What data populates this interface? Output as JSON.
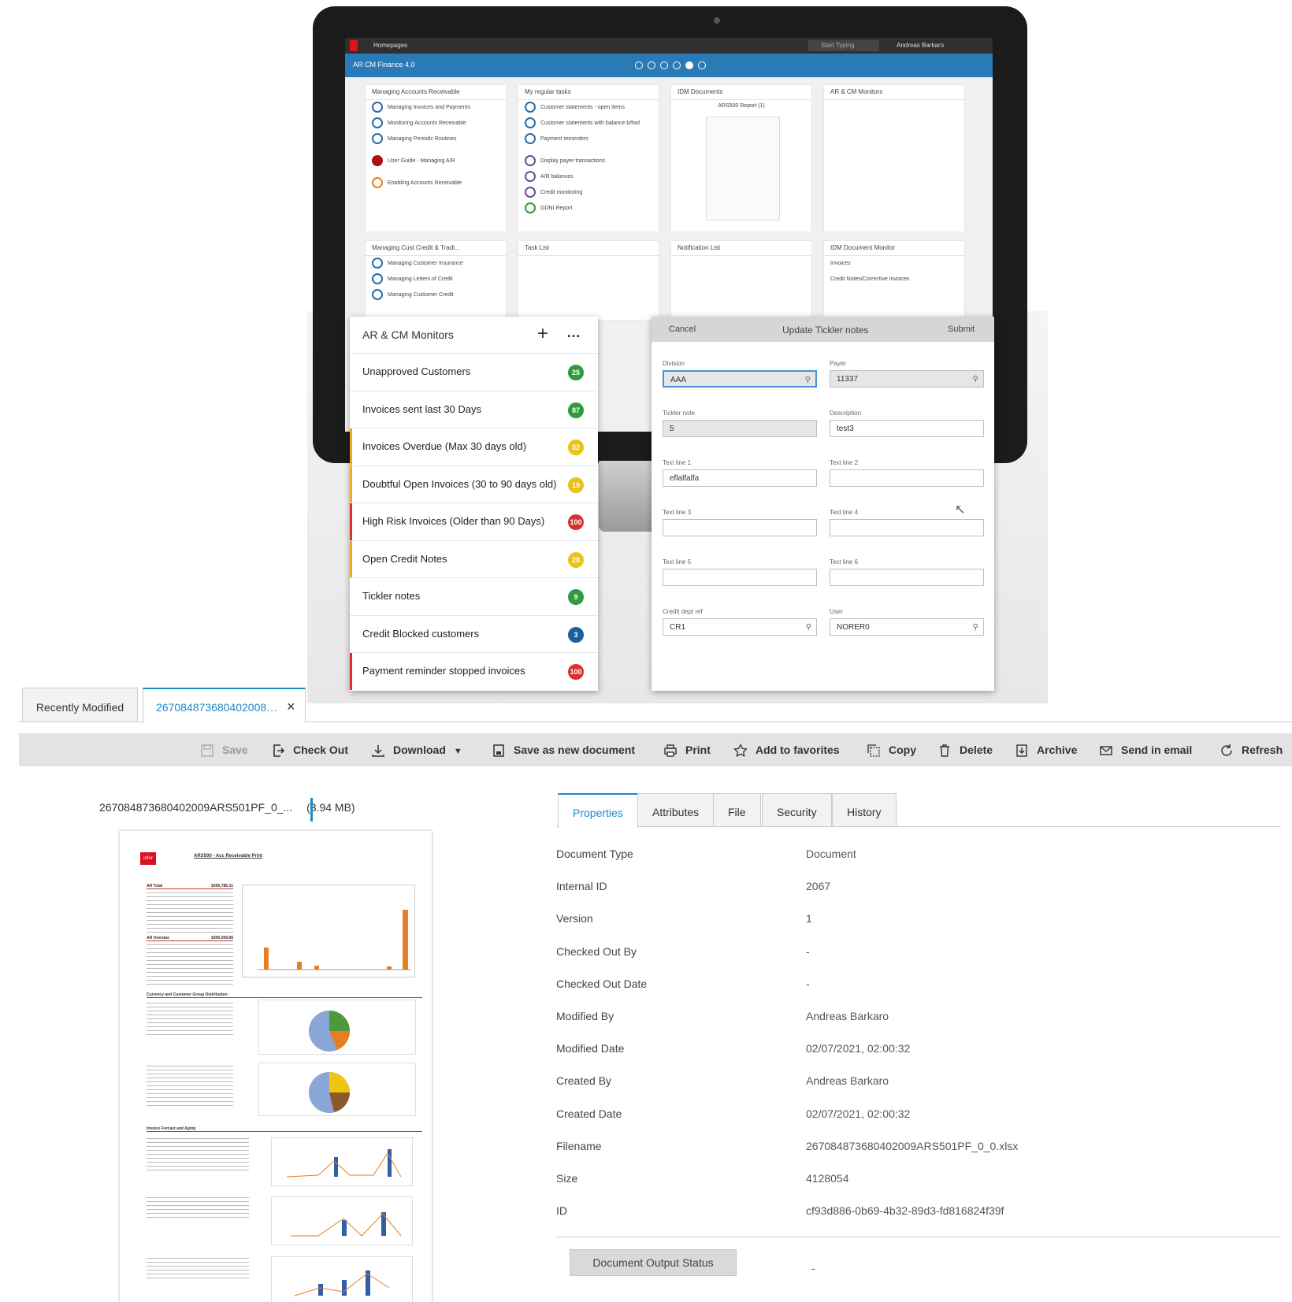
{
  "hero": {
    "topbar_title": "Homepages",
    "search_placeholder": "Start Typing",
    "user_name": "Andreas Barkaro",
    "workspace_title": "AR CM Finance 4.0",
    "widgets": {
      "managing_ar": {
        "title": "Managing Accounts Receivable",
        "items": [
          "Managing Invoices and Payments",
          "Monitoring Accounts Receivable",
          "Managing Periodic Routines",
          "User Guide - Managing A/R",
          "Enabling Accounts Receivable"
        ]
      },
      "regular_tasks": {
        "title": "My regular tasks",
        "items": [
          "Customer statements - open items",
          "Customer statements with balance b/fwd",
          "Payment reminders",
          "Display payer transactions",
          "A/R balances",
          "Credit monitoring",
          "GDNI Report"
        ]
      },
      "idm_documents": {
        "title": "IDM Documents",
        "report": "ARS500 Report (1)"
      },
      "ar_cm_small": {
        "title": "AR & CM Monitors"
      },
      "cust_credit": {
        "title": "Managing Cust Credit & Tradi...",
        "items": [
          "Managing Customer Insurance",
          "Managing Letters of Credit",
          "Managing Customer Credit"
        ]
      },
      "task_list": {
        "title": "Task List"
      },
      "notification_list": {
        "title": "Notification List"
      },
      "idm_monitor": {
        "title": "IDM Document Monitor",
        "items": [
          "Invoices",
          "Credit Notes/Corrective Invoices"
        ]
      }
    },
    "monitors": {
      "title": "AR & CM Monitors",
      "rows": [
        {
          "label": "Unapproved Customers",
          "count": "25",
          "badge": "#2e9b3c",
          "bar": ""
        },
        {
          "label": "Invoices sent last 30 Days",
          "count": "87",
          "badge": "#2e9b3c",
          "bar": ""
        },
        {
          "label": "Invoices Overdue (Max 30 days old)",
          "count": "32",
          "badge": "#e9c21a",
          "bar": "#f5a623"
        },
        {
          "label": "Doubtful Open Invoices (30 to 90 days old)",
          "count": "19",
          "badge": "#e9c21a",
          "bar": "#f5a623"
        },
        {
          "label": "High Risk Invoices (Older than 90 Days)",
          "count": "100",
          "badge": "#d9322e",
          "bar": "#d9322e"
        },
        {
          "label": "Open Credit Notes",
          "count": "28",
          "badge": "#e9c21a",
          "bar": "#f5a623"
        },
        {
          "label": "Tickler notes",
          "count": "9",
          "badge": "#2e9b3c",
          "bar": ""
        },
        {
          "label": "Credit Blocked customers",
          "count": "3",
          "badge": "#1a5fa0",
          "bar": ""
        },
        {
          "label": "Payment reminder stopped invoices",
          "count": "100",
          "badge": "#d9322e",
          "bar": "#d9322e"
        }
      ]
    },
    "ticker_form": {
      "cancel": "Cancel",
      "title": "Update Tickler notes",
      "submit": "Submit",
      "division_label": "Division",
      "division_value": "AAA",
      "payer_label": "Payer",
      "payer_value": "11337",
      "tickler_label": "Tickler note",
      "tickler_value": "5",
      "description_label": "Description",
      "description_value": "test3",
      "text1_label": "Text line 1",
      "text1_value": "eflalfalfa",
      "text2_label": "Text line 2",
      "text2_value": "",
      "text3_label": "Text line 3",
      "text3_value": "",
      "text4_label": "Text line 4",
      "text4_value": "",
      "text5_label": "Text line 5",
      "text5_value": "",
      "text6_label": "Text line 6",
      "text6_value": "",
      "credit_label": "Credit dept ref",
      "credit_value": "CR1",
      "user_label": "User",
      "user_value": "NORER0"
    }
  },
  "tabs": {
    "recent": "Recently Modified",
    "current": "267084873680402008…",
    "close": "×"
  },
  "toolbar": {
    "save": "Save",
    "checkout": "Check Out",
    "download": "Download",
    "save_new": "Save as new document",
    "print": "Print",
    "favorites": "Add to favorites",
    "copy": "Copy",
    "delete": "Delete",
    "archive": "Archive",
    "email": "Send in email",
    "refresh": "Refresh"
  },
  "file": {
    "name": "267084873680402009ARS501PF_0_...",
    "size": "(3.94 MB)"
  },
  "preview": {
    "doc_title": "ARS500 - Acc Receivable Print",
    "logo": "infor",
    "ar_total": "AR Total",
    "ar_total_value": "$356,786.31",
    "ar_overdue": "AR Overdue",
    "ar_overdue_value": "$300,009.86",
    "sec_currency": "Currency and Customer Group Distribution",
    "sec_invoice": "Invoice Forcast and Aging"
  },
  "prop_tabs": [
    "Properties",
    "Attributes",
    "File",
    "Security",
    "History"
  ],
  "properties": [
    {
      "key": "Document Type",
      "value": "Document"
    },
    {
      "key": "Internal ID",
      "value": "2067"
    },
    {
      "key": "Version",
      "value": "1"
    },
    {
      "key": "Checked Out By",
      "value": "-"
    },
    {
      "key": "Checked Out Date",
      "value": "-"
    },
    {
      "key": "Modified By",
      "value": "Andreas Barkaro"
    },
    {
      "key": "Modified Date",
      "value": "02/07/2021, 02:00:32"
    },
    {
      "key": "Created By",
      "value": "Andreas Barkaro"
    },
    {
      "key": "Created Date",
      "value": "02/07/2021, 02:00:32"
    },
    {
      "key": "Filename",
      "value": "267084873680402009ARS501PF_0_0.xlsx"
    },
    {
      "key": "Size",
      "value": "4128054"
    },
    {
      "key": "ID",
      "value": "cf93d886-0b69-4b32-89d3-fd816824f39f"
    }
  ],
  "output": {
    "button": "Document Output Status",
    "value": "-"
  },
  "colors": {
    "accent": "#1e88c7",
    "titlebar": "#2b7ab8"
  }
}
